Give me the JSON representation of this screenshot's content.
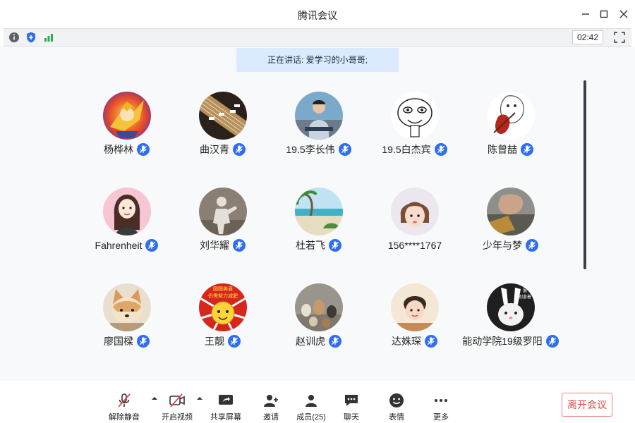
{
  "window": {
    "title": "腾讯会议"
  },
  "status_bar": {
    "timer": "02:42"
  },
  "speaking": {
    "text": "正在讲话: 爱学习的小哥哥;"
  },
  "participants": [
    {
      "name": "杨桦林",
      "avatar": "anime-avatar"
    },
    {
      "name": "曲汉青",
      "avatar": "guitar-avatar"
    },
    {
      "name": "19.5李长伟",
      "avatar": "person-avatar"
    },
    {
      "name": "19.5白杰宾",
      "avatar": "meme-face-avatar"
    },
    {
      "name": "陈曾喆",
      "avatar": "violin-avatar"
    },
    {
      "name": "Fahrenheit",
      "avatar": "girl-drawing-avatar"
    },
    {
      "name": "刘华耀",
      "avatar": "statue-avatar"
    },
    {
      "name": "杜若飞",
      "avatar": "beach-avatar"
    },
    {
      "name": "156****1767",
      "avatar": "child-avatar"
    },
    {
      "name": "少年与梦",
      "avatar": "photo-avatar"
    },
    {
      "name": "廖国樑",
      "avatar": "corgi-avatar"
    },
    {
      "name": "王靓",
      "avatar": "sun-cartoon-avatar"
    },
    {
      "name": "赵训虎",
      "avatar": "cats-avatar"
    },
    {
      "name": "达姝琛",
      "avatar": "toddler-avatar"
    },
    {
      "name": "能动学院19级罗阳",
      "avatar": "rabbit-avatar"
    }
  ],
  "avatar_texts": {
    "sun": [
      "圆圆美眉",
      "仍需努力减肥"
    ],
    "rabbit": [
      "呆",
      "别害着"
    ]
  },
  "toolbar": {
    "unmute": "解除静音",
    "video": "开启视频",
    "share": "共享屏幕",
    "invite": "邀请",
    "members": "成员(25)",
    "chat": "聊天",
    "emoji": "表情",
    "more": "更多",
    "leave": "离开会议"
  },
  "colors": {
    "accent": "#2f6fed",
    "leave": "#e34646",
    "speaking_bg": "#dbeafe"
  }
}
